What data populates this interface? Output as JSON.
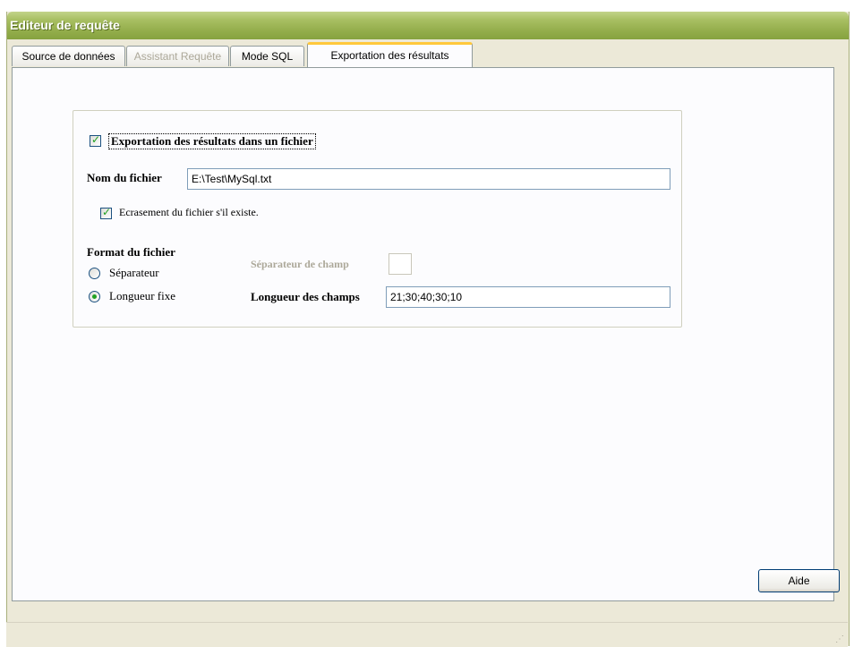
{
  "window": {
    "title": "Editeur de requête"
  },
  "tabs": [
    {
      "label": "Source de données",
      "state": "normal"
    },
    {
      "label": "Assistant Requête",
      "state": "disabled"
    },
    {
      "label": "Mode SQL",
      "state": "normal"
    },
    {
      "label": "Exportation des résultats",
      "state": "active"
    }
  ],
  "export": {
    "export_checkbox_label": "Exportation des résultats dans un fichier",
    "export_checked": true,
    "filename_label": "Nom du fichier",
    "filename_value": "E:\\Test\\MySql.txt",
    "overwrite_label": "Ecrasement du fichier s'il existe.",
    "overwrite_checked": true,
    "format_label": "Format du fichier",
    "radio_separator_label": "Séparateur",
    "radio_fixed_label": "Longueur fixe",
    "selected_format": "Longueur fixe",
    "field_separator_label": "Séparateur de champ",
    "field_separator_value": "",
    "field_lengths_label": "Longueur des champs",
    "field_lengths_value": "21;30;40;30;10"
  },
  "buttons": {
    "help_label": "Aide"
  },
  "colors": {
    "titlebar": "#93ad4b",
    "active_tab_accent": "#ffc83c",
    "check_green": "#21a121"
  }
}
